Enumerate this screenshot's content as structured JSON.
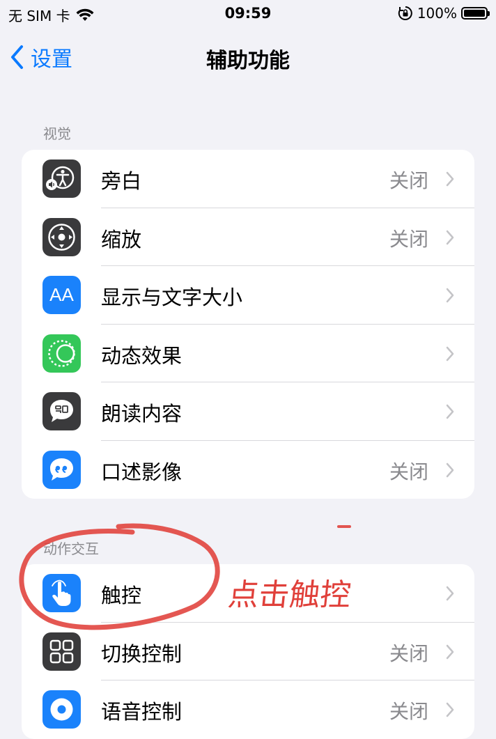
{
  "status_bar": {
    "carrier": "无 SIM 卡",
    "time": "09:59",
    "battery": "100%",
    "battery_level": 1.0
  },
  "nav": {
    "back_label": "设置",
    "title": "辅助功能"
  },
  "vision": {
    "header": "视觉",
    "items": [
      {
        "label": "旁白",
        "value": "关闭",
        "icon": "voiceover-icon",
        "color": "#3a3a3c"
      },
      {
        "label": "缩放",
        "value": "关闭",
        "icon": "zoom-icon",
        "color": "#3a3a3c"
      },
      {
        "label": "显示与文字大小",
        "value": "",
        "icon": "text-size-icon",
        "icon_text": "AA",
        "color": "#1a82fb"
      },
      {
        "label": "动态效果",
        "value": "",
        "icon": "motion-icon",
        "color": "#34c759"
      },
      {
        "label": "朗读内容",
        "value": "",
        "icon": "spoken-content-icon",
        "color": "#3a3a3c"
      },
      {
        "label": "口述影像",
        "value": "关闭",
        "icon": "audio-description-icon",
        "color": "#1a82fb"
      }
    ]
  },
  "interaction": {
    "header": "动作交互",
    "items": [
      {
        "label": "触控",
        "value": "",
        "icon": "touch-hand-icon",
        "color": "#1a82fb"
      },
      {
        "label": "切换控制",
        "value": "关闭",
        "icon": "switch-control-icon",
        "color": "#3a3a3c"
      },
      {
        "label": "语音控制",
        "value": "关闭",
        "icon": "voice-control-icon",
        "color": "#1a82fb"
      }
    ]
  },
  "annotation": {
    "text": "点击触控",
    "color": "#e0403a"
  }
}
